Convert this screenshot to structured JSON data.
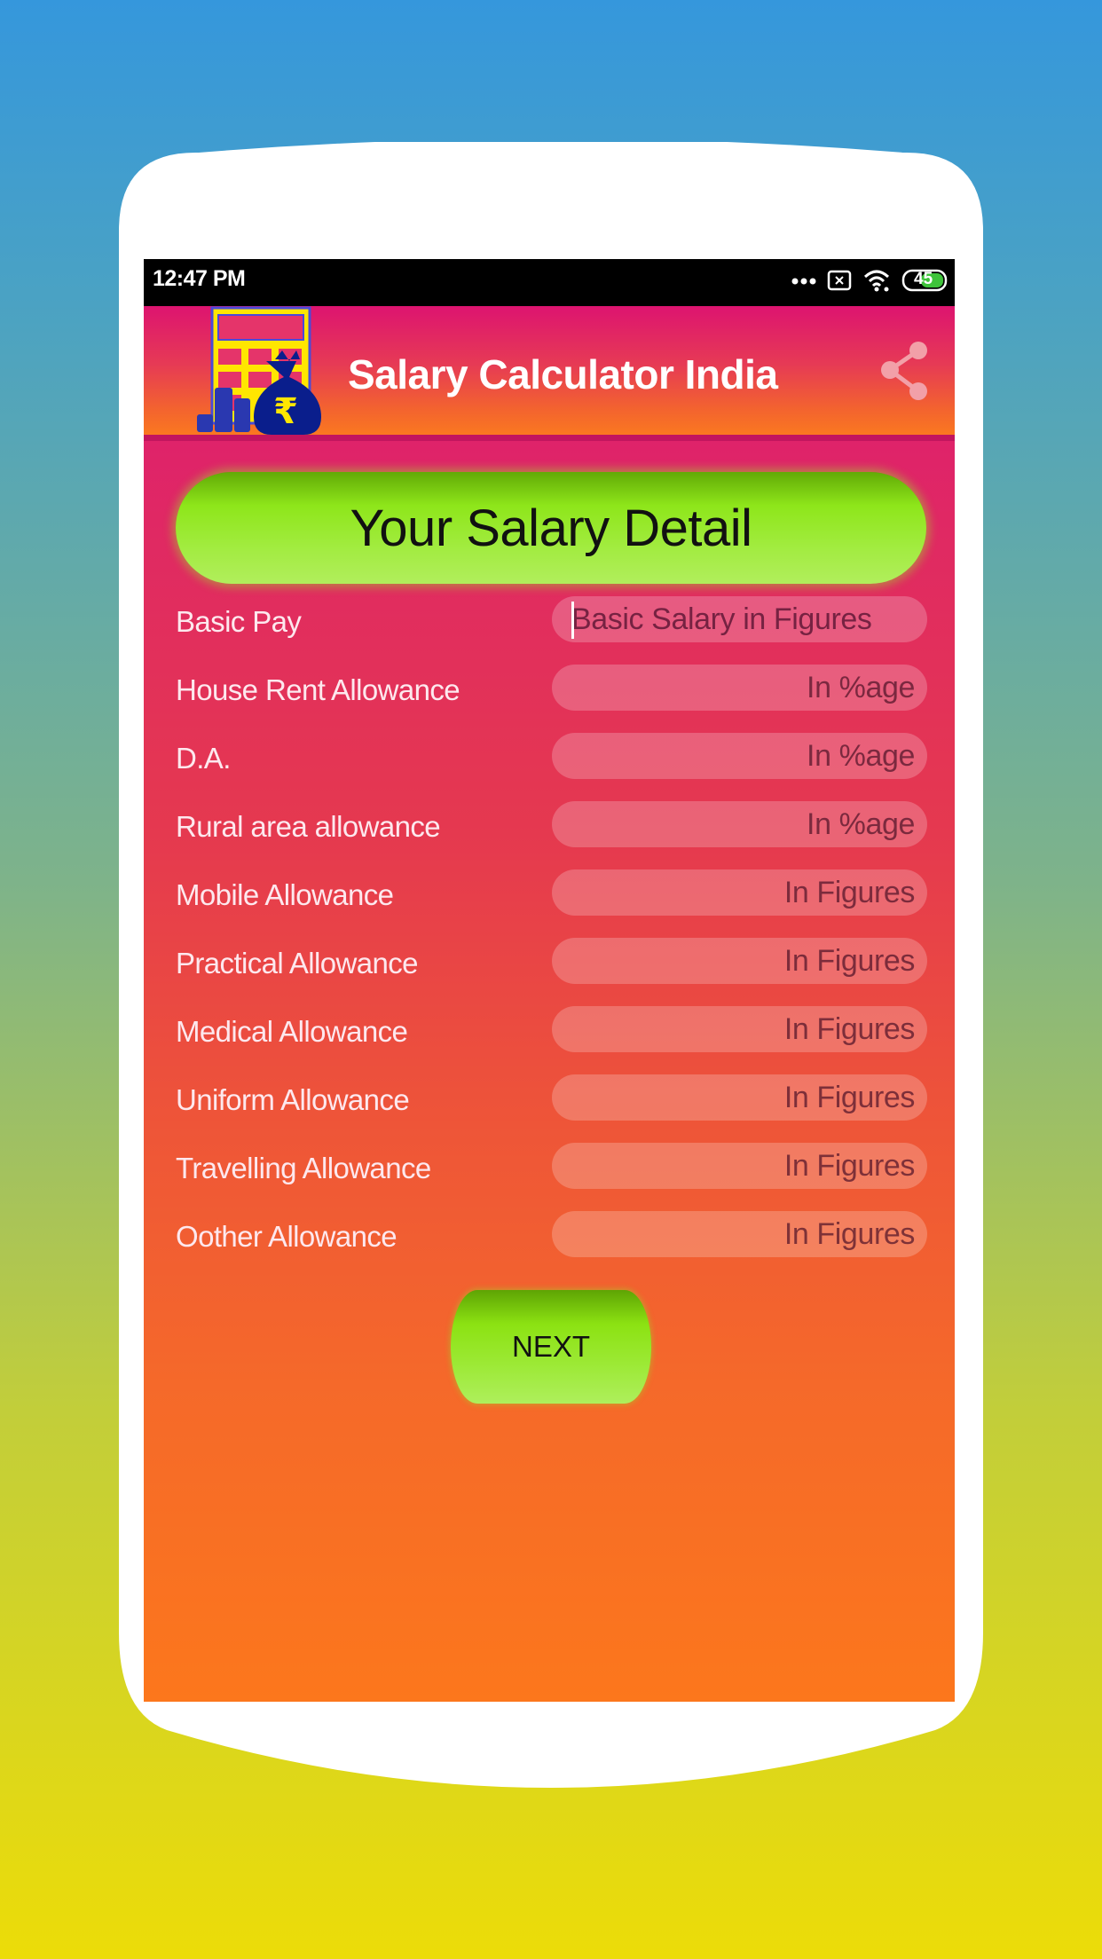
{
  "status_bar": {
    "time": "12:47 PM",
    "battery_level": "45",
    "icons": [
      "more-dots-icon",
      "close-box-icon",
      "wifi-icon",
      "battery-icon"
    ]
  },
  "app_bar": {
    "title": "Salary Calculator India",
    "logo_icon": "calculator-money-bag-icon",
    "share_icon": "share-icon"
  },
  "header": {
    "title": "Your Salary Detail"
  },
  "form": {
    "fields": [
      {
        "label": "Basic Pay",
        "placeholder": "Basic Salary in Figures",
        "value": ""
      },
      {
        "label": "House Rent Allowance",
        "placeholder": "In %age",
        "value": ""
      },
      {
        "label": "D.A.",
        "placeholder": "In %age",
        "value": ""
      },
      {
        "label": "Rural area allowance",
        "placeholder": "In %age",
        "value": ""
      },
      {
        "label": "Mobile Allowance",
        "placeholder": "In Figures",
        "value": ""
      },
      {
        "label": "Practical Allowance",
        "placeholder": "In Figures",
        "value": ""
      },
      {
        "label": "Medical Allowance",
        "placeholder": "In Figures",
        "value": ""
      },
      {
        "label": "Uniform Allowance",
        "placeholder": "In Figures",
        "value": ""
      },
      {
        "label": "Travelling Allowance",
        "placeholder": "In Figures",
        "value": ""
      },
      {
        "label": "Oother Allowance",
        "placeholder": "In Figures",
        "value": ""
      }
    ],
    "next_label": "NEXT"
  },
  "colors": {
    "appbar_top": "#dd1470",
    "appbar_bottom": "#fa7820",
    "accent_green": "#8ee61a",
    "screen_bottom": "#fc771c"
  }
}
